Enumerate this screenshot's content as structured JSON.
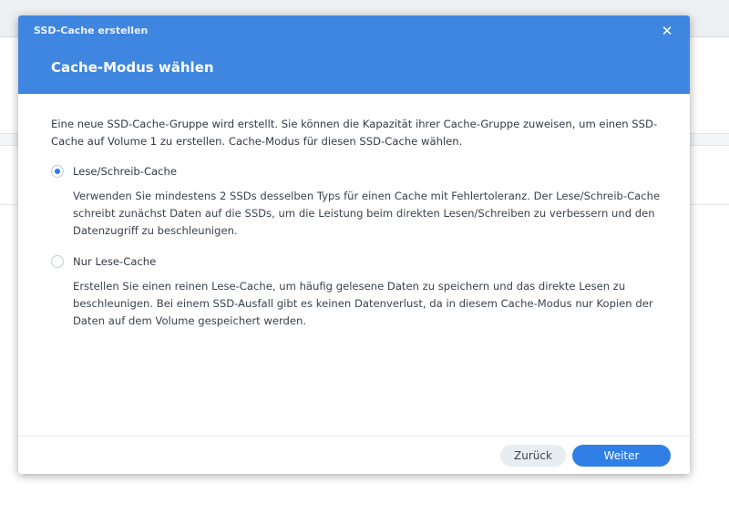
{
  "window": {
    "title": "SSD-Cache erstellen",
    "close_glyph": "✕"
  },
  "header": {
    "step_title": "Cache-Modus wählen"
  },
  "body": {
    "intro": "Eine neue SSD-Cache-Gruppe wird erstellt. Sie können die Kapazität ihrer Cache-Gruppe zuweisen, um einen SSD-Cache auf Volume 1 zu erstellen. Cache-Modus für diesen SSD-Cache wählen.",
    "options": [
      {
        "label": "Lese/Schreib-Cache",
        "description": "Verwenden Sie mindestens 2 SSDs desselben Typs für einen Cache mit Fehlertoleranz. Der Lese/Schreib-Cache schreibt zunächst Daten auf die SSDs, um die Leistung beim direkten Lesen/Schreiben zu verbessern und den Datenzugriff zu beschleunigen.",
        "selected": true
      },
      {
        "label": "Nur Lese-Cache",
        "description": "Erstellen Sie einen reinen Lese-Cache, um häufig gelesene Daten zu speichern und das direkte Lesen zu beschleunigen. Bei einem SSD-Ausfall gibt es keinen Datenverlust, da in diesem Cache-Modus nur Kopien der Daten auf dem Volume gespeichert werden.",
        "selected": false
      }
    ]
  },
  "footer": {
    "back_label": "Zurück",
    "next_label": "Weiter"
  },
  "colors": {
    "header_blue": "#3f86e0",
    "primary_button": "#2f7fe6",
    "radio_selected": "#2d7be5"
  }
}
